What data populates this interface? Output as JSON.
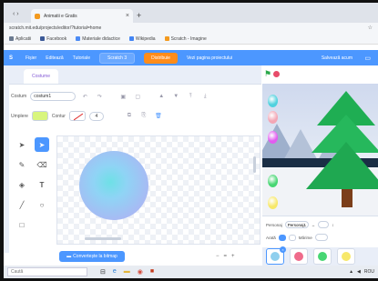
{
  "browser": {
    "tab_title": "Animatii e Gratis",
    "new_tab_symbol": "+",
    "close_symbol": "×",
    "nav_symbols": "‹ ›",
    "url": "scratch.mit.edu/projects/editor/?tutorial=home",
    "bookmarks": [
      {
        "label": "Aplicatii",
        "color": "#6b7a90"
      },
      {
        "label": "Facebook",
        "color": "#3b5998"
      },
      {
        "label": "Materiale didactice",
        "color": "#4c8bf5"
      },
      {
        "label": "Wikipedia",
        "color": "#4285f4"
      },
      {
        "label": "Scratch - Imagine",
        "color": "#f39a1f"
      }
    ]
  },
  "menubar": {
    "logo": "S",
    "file": "Fișier",
    "edit": "Editează",
    "tutorials": "Tutoriale",
    "project_title": "Scratch 3",
    "share": "Distribuie",
    "see_project": "Vezi pagina proiectului",
    "save_now": "Salvează acum",
    "folder_icon": "folder-icon"
  },
  "editor": {
    "costumes_tab": "Costume",
    "costume_label": "Costum",
    "costume_name": "costum1",
    "fill_label": "Umplere",
    "outline_label": "Contur",
    "outline_width": "4",
    "fill_color": "#d8f57d",
    "convert_button": "Convertește la bitmap",
    "zoom_out": "−",
    "zoom_reset": "=",
    "zoom_in": "+"
  },
  "stage": {
    "green_flag_symbol": "⚑",
    "bubble_colors": [
      "#4fd1de",
      "#f3a6b5",
      "#e25cf0",
      "#47d673",
      "#f7e86a"
    ]
  },
  "sprite_info": {
    "sprite_label": "Personaj",
    "sprite_name": "Personaj1",
    "show_label": "Arată",
    "size_label": "Mărime"
  },
  "sprites": [
    {
      "color": "#8fcfee",
      "selected": true
    },
    {
      "color": "#ef6b8b",
      "selected": false
    },
    {
      "color": "#47d673",
      "selected": false
    },
    {
      "color": "#f7e86a",
      "selected": false
    }
  ],
  "taskbar": {
    "search_placeholder": "Caută",
    "tray_text": "ROU"
  }
}
